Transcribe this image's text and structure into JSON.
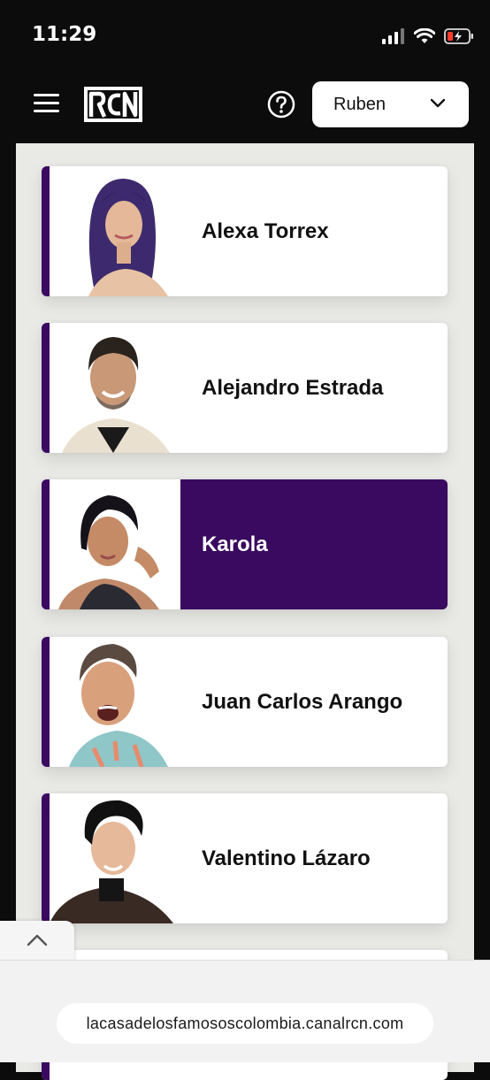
{
  "status_bar": {
    "time": "11:29"
  },
  "header": {
    "logo_text": "RCN",
    "user_select": {
      "selected": "Ruben"
    }
  },
  "contestants": [
    {
      "name": "Alexa Torrex",
      "selected": false
    },
    {
      "name": "Alejandro Estrada",
      "selected": false
    },
    {
      "name": "Karola",
      "selected": true
    },
    {
      "name": "Juan Carlos Arango",
      "selected": false
    },
    {
      "name": "Valentino Lázaro",
      "selected": false
    }
  ],
  "browser": {
    "url": "lacasadelosfamososcolombia.canalrcn.com"
  },
  "colors": {
    "accent": "#3a0a60",
    "background": "#0c0c0d",
    "panel": "#e9e9e6"
  },
  "icons": [
    "menu-icon",
    "help-icon",
    "chevron-down-icon",
    "chevron-up-icon",
    "signal-icon",
    "wifi-icon",
    "battery-icon"
  ]
}
